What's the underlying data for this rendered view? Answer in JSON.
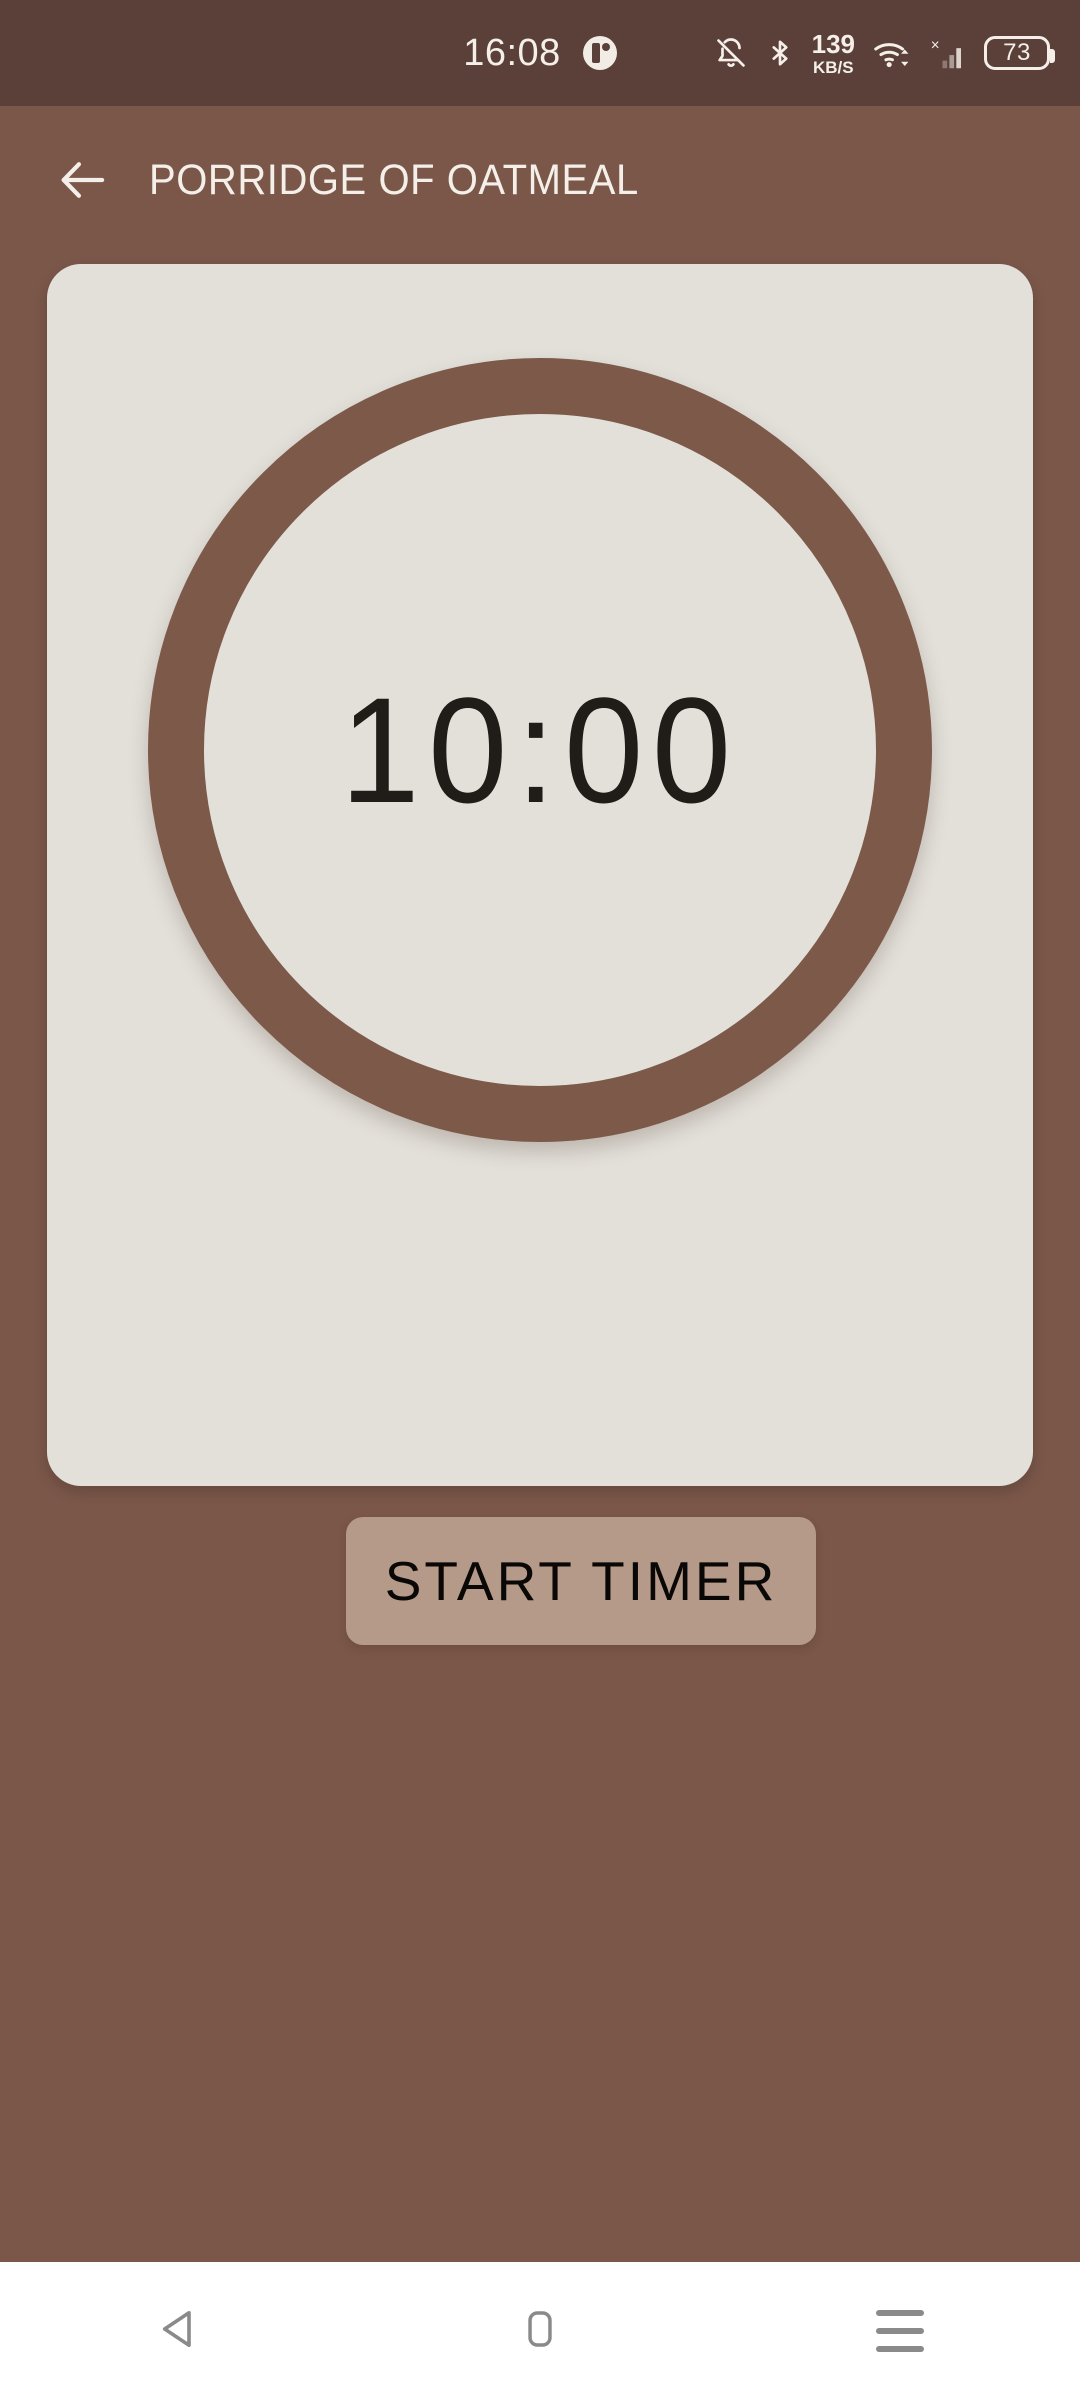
{
  "status_bar": {
    "clock": "16:08",
    "app_badge_icon": "app-notification-icon",
    "icons": [
      {
        "name": "notifications-muted-icon",
        "label": "Notifications muted"
      },
      {
        "name": "bluetooth-icon",
        "label": "Bluetooth"
      }
    ],
    "network_speed": {
      "value": "139",
      "unit": "KB/S"
    },
    "wifi_icon": "wifi-icon",
    "cellular": {
      "icon": "cellular-signal-icon",
      "no_service_marker": "×"
    },
    "battery": {
      "icon": "battery-icon",
      "percent": "73"
    },
    "background_color": "#5a4038",
    "text_color": "#f4efe9"
  },
  "app_bar": {
    "back_icon": "back-arrow-icon",
    "title": "PORRIDGE OF OATMEAL"
  },
  "timer_card": {
    "background_color": "#e3e0da",
    "ring_color": "#7c5948",
    "time_display": "10:00",
    "start_button": {
      "label": "START TIMER",
      "background_color": "#b59a89",
      "text_color": "#090806"
    }
  },
  "page": {
    "background_color": "#7a5749"
  },
  "nav_bar": {
    "background_color": "#ffffff",
    "icon_color": "#8a8a8a",
    "buttons": [
      {
        "name": "nav-back-button",
        "icon": "triangle-back-icon"
      },
      {
        "name": "nav-home-button",
        "icon": "rounded-square-home-icon"
      },
      {
        "name": "nav-recents-button",
        "icon": "hamburger-menu-icon"
      }
    ]
  }
}
